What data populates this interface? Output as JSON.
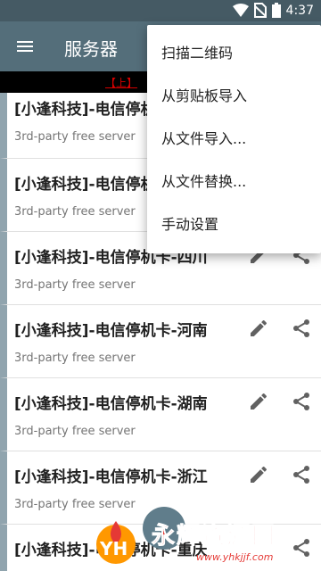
{
  "status_bar": {
    "time": "4:37"
  },
  "app_bar": {
    "title": "服务器"
  },
  "notice": {
    "text": "【上】"
  },
  "menu": {
    "items": [
      {
        "label": "扫描二维码"
      },
      {
        "label": "从剪贴板导入"
      },
      {
        "label": "从文件导入..."
      },
      {
        "label": "从文件替换..."
      },
      {
        "label": "手动设置"
      }
    ]
  },
  "servers": [
    {
      "name": "[小逢科技]-电信停机卡",
      "subtitle": "3rd-party free server"
    },
    {
      "name": "[小逢科技]-电信停机卡",
      "subtitle": "3rd-party free server"
    },
    {
      "name": "[小逢科技]-电信停机卡-四川",
      "subtitle": "3rd-party free server"
    },
    {
      "name": "[小逢科技]-电信停机卡-河南",
      "subtitle": "3rd-party free server"
    },
    {
      "name": "[小逢科技]-电信停机卡-湖南",
      "subtitle": "3rd-party free server"
    },
    {
      "name": "[小逢科技]-电信停机卡-浙江",
      "subtitle": "3rd-party free server"
    },
    {
      "name": "[小逢科技]-电信停机卡-重庆",
      "subtitle": ""
    }
  ],
  "watermark": {
    "text": "永辉资源网",
    "url": "www.yhkjjf.com",
    "logo_text": "YH"
  },
  "colors": {
    "status_bar": "#455a64",
    "app_bar": "#546e7a",
    "item_border": "#90a4ae",
    "fab": "#607d8b",
    "watermark": "#e53935"
  }
}
